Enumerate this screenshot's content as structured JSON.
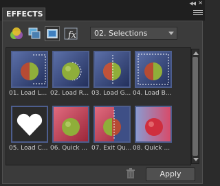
{
  "panel": {
    "tab_label": "EFFECTS"
  },
  "toolbar": {
    "category_icons": [
      "filters-icon",
      "layer-styles-icon",
      "photo-effects-icon",
      "all-icon"
    ],
    "dropdown_value": "02. Selections"
  },
  "effects": [
    {
      "label": "01. Load L..."
    },
    {
      "label": "02. Load R..."
    },
    {
      "label": "03. Load G..."
    },
    {
      "label": "04. Load B..."
    },
    {
      "label": "05. Load C..."
    },
    {
      "label": "06. Quick ..."
    },
    {
      "label": "07. Exit Qu..."
    },
    {
      "label": "08. Quick ..."
    }
  ],
  "footer": {
    "apply_label": "Apply"
  },
  "colors": {
    "panel_bg": "#3b3b3b",
    "thumb_border": "#4d5e8e"
  }
}
